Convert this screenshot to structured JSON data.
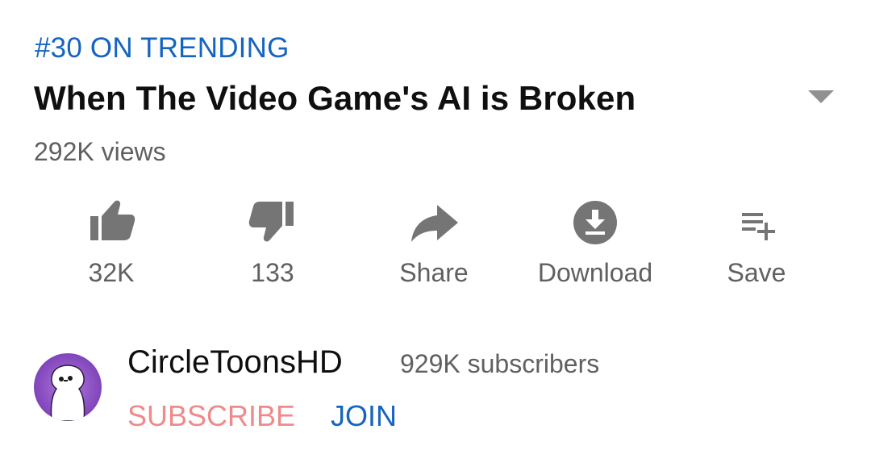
{
  "video": {
    "trending_label": "#30 ON TRENDING",
    "title": "When The Video Game's AI is Broken",
    "views": "292K views"
  },
  "actions": {
    "like": {
      "label": "32K",
      "icon": "thumbs-up-icon"
    },
    "dislike": {
      "label": "133",
      "icon": "thumbs-down-icon"
    },
    "share": {
      "label": "Share",
      "icon": "share-arrow-icon"
    },
    "download": {
      "label": "Download",
      "icon": "download-icon"
    },
    "save": {
      "label": "Save",
      "icon": "add-to-playlist-icon"
    }
  },
  "channel": {
    "name": "CircleToonsHD",
    "subscribers": "929K subscribers",
    "subscribe_label": "SUBSCRIBE",
    "join_label": "JOIN"
  },
  "colors": {
    "trending_blue": "#1565c0",
    "subscribe_red": "#ef8a8a",
    "icon_grey": "#757575",
    "avatar_purple": "#7b3fb5"
  }
}
